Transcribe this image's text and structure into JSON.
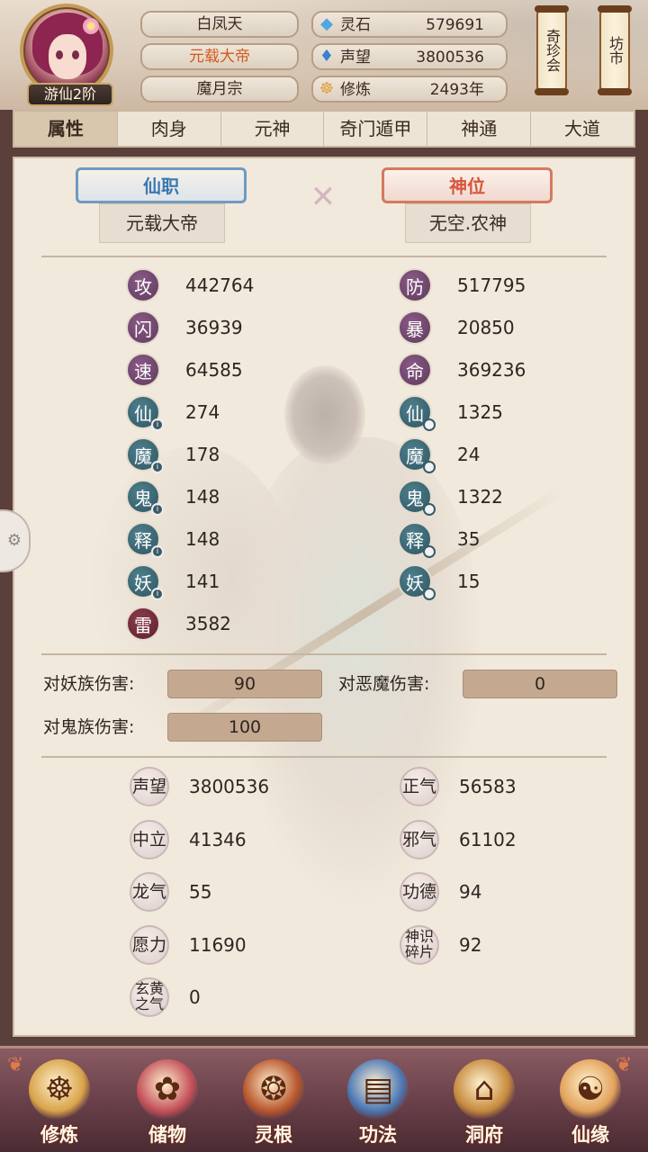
{
  "player": {
    "rank_badge": "游仙2阶",
    "name": "白凤天",
    "title": "元载大帝",
    "sect": "魔月宗"
  },
  "resources": [
    {
      "icon": "spirit-stone-icon",
      "glyph": "◆",
      "color": "#4fa6e0",
      "name": "灵石",
      "value": "579691"
    },
    {
      "icon": "reputation-icon",
      "glyph": "♦",
      "color": "#3d7fd1",
      "name": "声望",
      "value": "3800536"
    },
    {
      "icon": "cultivation-icon",
      "glyph": "☸",
      "color": "#e0a040",
      "name": "修炼",
      "value": "2493年"
    }
  ],
  "side_buttons": {
    "treasure": "奇珍会",
    "market": "坊市"
  },
  "tabs": [
    "属性",
    "肉身",
    "元神",
    "奇门遁甲",
    "神通",
    "大道"
  ],
  "active_tab": 0,
  "immortal_post": {
    "label": "仙职",
    "value": "元载大帝"
  },
  "divine_seat": {
    "label": "神位",
    "value": "无空.农神"
  },
  "stats_left": [
    {
      "glyph": "攻",
      "value": "442764",
      "style": "purple",
      "sub": ""
    },
    {
      "glyph": "闪",
      "value": "36939",
      "style": "purple",
      "sub": ""
    },
    {
      "glyph": "速",
      "value": "64585",
      "style": "purple",
      "sub": ""
    },
    {
      "glyph": "仙",
      "value": "274",
      "style": "teal",
      "sub": "i"
    },
    {
      "glyph": "魔",
      "value": "178",
      "style": "teal",
      "sub": "i"
    },
    {
      "glyph": "鬼",
      "value": "148",
      "style": "teal",
      "sub": "i"
    },
    {
      "glyph": "释",
      "value": "148",
      "style": "teal",
      "sub": "i"
    },
    {
      "glyph": "妖",
      "value": "141",
      "style": "teal",
      "sub": "i"
    },
    {
      "glyph": "雷",
      "value": "3582",
      "style": "red",
      "sub": ""
    }
  ],
  "stats_right": [
    {
      "glyph": "防",
      "value": "517795",
      "style": "purple",
      "sub": ""
    },
    {
      "glyph": "暴",
      "value": "20850",
      "style": "purple",
      "sub": ""
    },
    {
      "glyph": "命",
      "value": "369236",
      "style": "purple",
      "sub": ""
    },
    {
      "glyph": "仙",
      "value": "1325",
      "style": "teal",
      "sub": "o"
    },
    {
      "glyph": "魔",
      "value": "24",
      "style": "teal",
      "sub": "o"
    },
    {
      "glyph": "鬼",
      "value": "1322",
      "style": "teal",
      "sub": "o"
    },
    {
      "glyph": "释",
      "value": "35",
      "style": "teal",
      "sub": "o"
    },
    {
      "glyph": "妖",
      "value": "15",
      "style": "teal",
      "sub": "o"
    }
  ],
  "damage": [
    {
      "label": "对妖族伤害:",
      "value": "90"
    },
    {
      "label": "对恶魔伤害:",
      "value": "0"
    },
    {
      "label": "对鬼族伤害:",
      "value": "100"
    }
  ],
  "reputation_left": [
    {
      "name": "声望",
      "value": "3800536"
    },
    {
      "name": "中立",
      "value": "41346"
    },
    {
      "name": "龙气",
      "value": "55"
    },
    {
      "name": "愿力",
      "value": "11690"
    },
    {
      "name": "玄黄之气",
      "value": "0"
    }
  ],
  "reputation_right": [
    {
      "name": "正气",
      "value": "56583"
    },
    {
      "name": "邪气",
      "value": "61102"
    },
    {
      "name": "功德",
      "value": "94"
    },
    {
      "name": "神识碎片",
      "value": "92"
    }
  ],
  "bottom_nav": [
    {
      "label": "修炼",
      "icon": "meditating-monk-icon",
      "glyph": "☸",
      "bg": "#d9a34a"
    },
    {
      "label": "储物",
      "icon": "treasure-bag-icon",
      "glyph": "✿",
      "bg": "#c4505a"
    },
    {
      "label": "灵根",
      "icon": "spirit-root-icon",
      "glyph": "❂",
      "bg": "#b8562c"
    },
    {
      "label": "功法",
      "icon": "scripture-book-icon",
      "glyph": "▤",
      "bg": "#4a77b5"
    },
    {
      "label": "洞府",
      "icon": "cave-palace-icon",
      "glyph": "⌂",
      "bg": "#c68a3c"
    },
    {
      "label": "仙缘",
      "icon": "gourd-icon",
      "glyph": "☯",
      "bg": "#e2a25a"
    }
  ]
}
